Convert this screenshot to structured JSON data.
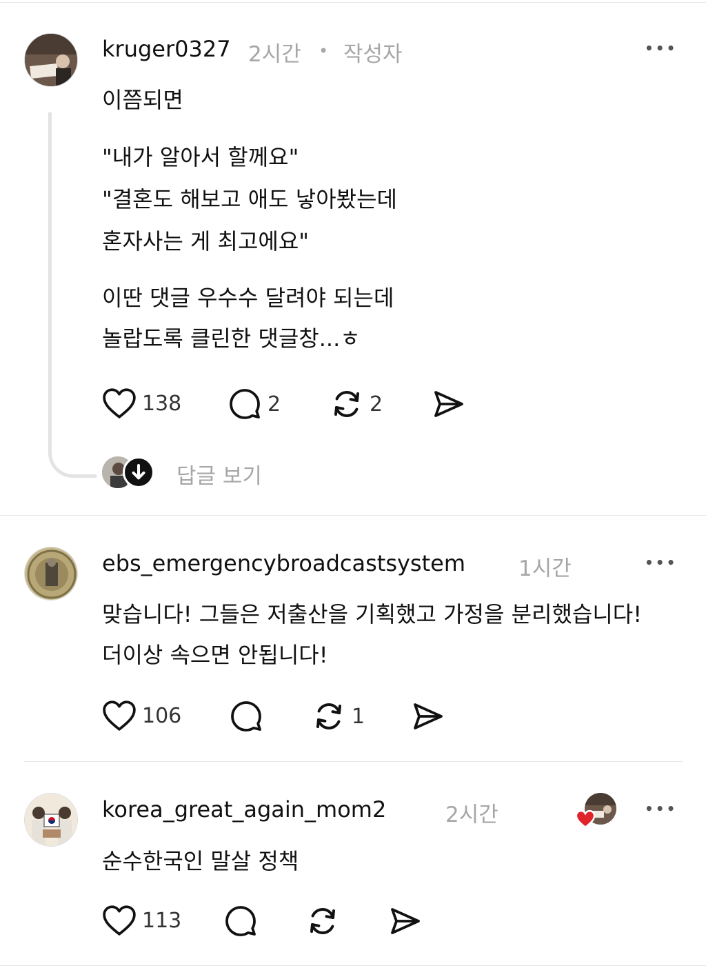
{
  "comments": [
    {
      "username": "kruger0327",
      "time": "2시간",
      "separator": "•",
      "badge": "작성자",
      "more": "•••",
      "lines": [
        "이쯤되면",
        "\"내가 알아서 할께요\"",
        "\"결혼도 해보고 애도 낳아봤는데",
        "혼자사는 게 최고에요\"",
        "이딴 댓글 우수수 달려야 되는데",
        "놀랍도록 클린한 댓글창...ㅎ"
      ],
      "likes": "138",
      "replies": "2",
      "reposts": "2",
      "view_replies": "답글 보기"
    },
    {
      "username": "ebs_emergencybroadcastsystem",
      "time": "1시간",
      "more": "•••",
      "lines": [
        "맞습니다! 그들은 저출산을 기획했고 가정을 분리했습니다!",
        "더이상 속으면 안됩니다!"
      ],
      "likes": "106",
      "reposts": "1"
    },
    {
      "username": "korea_great_again_mom2",
      "time": "2시간",
      "more": "•••",
      "lines": [
        "순수한국인 말살 정책"
      ],
      "likes": "113"
    }
  ],
  "colors": {
    "text": "#111111",
    "muted": "#a6a6a6",
    "divider": "#e6e6e6",
    "liked_heart": "#e0242b"
  },
  "icons": [
    "heart-icon",
    "comment-icon",
    "repost-icon",
    "share-icon",
    "arrow-down-icon",
    "more-icon"
  ]
}
